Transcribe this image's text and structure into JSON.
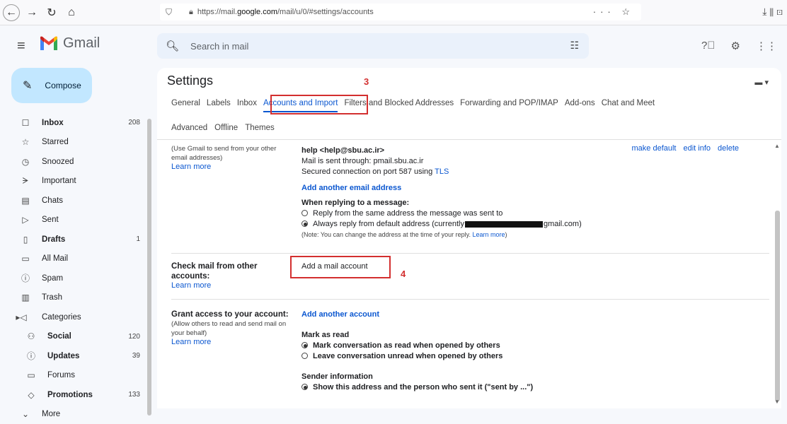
{
  "browser": {
    "url_prefix": "https://mail.",
    "url_domain": "google.com",
    "url_suffix": "/mail/u/0/#settings/accounts",
    "page_actions": "··· ☆",
    "toolbar_icons": "⤓ ⫴ ⊡"
  },
  "header": {
    "app_name": "Gmail",
    "search_placeholder": "Search in mail"
  },
  "sidebar": {
    "compose_label": "Compose",
    "items": [
      {
        "icon": "inbox-icon",
        "glyph": "☐",
        "label": "Inbox",
        "count": "208",
        "bold": true
      },
      {
        "icon": "star-icon",
        "glyph": "☆",
        "label": "Starred",
        "count": ""
      },
      {
        "icon": "clock-icon",
        "glyph": "◷",
        "label": "Snoozed",
        "count": ""
      },
      {
        "icon": "important-icon",
        "glyph": "ᗒ",
        "label": "Important",
        "count": ""
      },
      {
        "icon": "chat-icon",
        "glyph": "▤",
        "label": "Chats",
        "count": ""
      },
      {
        "icon": "send-icon",
        "glyph": "▷",
        "label": "Sent",
        "count": ""
      },
      {
        "icon": "draft-icon",
        "glyph": "▯",
        "label": "Drafts",
        "count": "1",
        "bold": true
      },
      {
        "icon": "all-mail-icon",
        "glyph": "▭",
        "label": "All Mail",
        "count": ""
      },
      {
        "icon": "spam-icon",
        "glyph": "ⓘ",
        "label": "Spam",
        "count": ""
      },
      {
        "icon": "trash-icon",
        "glyph": "▥",
        "label": "Trash",
        "count": ""
      },
      {
        "icon": "category-icon",
        "glyph": "▸◁",
        "label": "Categories",
        "count": ""
      },
      {
        "icon": "social-icon",
        "glyph": "⚇",
        "label": "Social",
        "count": "120",
        "bold": true,
        "sub": true
      },
      {
        "icon": "info-icon",
        "glyph": "ⓘ",
        "label": "Updates",
        "count": "39",
        "bold": true,
        "sub": true
      },
      {
        "icon": "forum-icon",
        "glyph": "▭",
        "label": "Forums",
        "count": "",
        "sub": true
      },
      {
        "icon": "tag-icon",
        "glyph": "◇",
        "label": "Promotions",
        "count": "133",
        "bold": true,
        "sub": true
      },
      {
        "icon": "chevron-down-icon",
        "glyph": "⌄",
        "label": "More",
        "count": ""
      }
    ]
  },
  "settings": {
    "title": "Settings",
    "tabs_row1": [
      "General",
      "Labels",
      "Inbox",
      "Accounts and Import",
      "Filters and Blocked Addresses",
      "Forwarding and POP/IMAP",
      "Add-ons",
      "Chat and Meet"
    ],
    "active_tab": "Accounts and Import",
    "tabs_row2": [
      "Advanced",
      "Offline",
      "Themes"
    ],
    "annotation_3": "3",
    "annotation_4": "4",
    "send_as": {
      "left_line1": "(Use Gmail to send from your other",
      "left_line2": "email addresses)",
      "learn_more": "Learn more",
      "address": "help <help@sbu.ac.ir>",
      "sent_through": "Mail is sent through: pmail.sbu.ac.ir",
      "secured_prefix": "Secured connection on port 587 using ",
      "secured_link": "TLS",
      "make_default": "make default",
      "edit_info": "edit info",
      "delete": "delete",
      "add_another_email": "Add another email address",
      "reply_heading": "When replying to a message:",
      "reply_opt1": "Reply from the same address the message was sent to",
      "reply_opt2_prefix": "Always reply from default address (currently",
      "reply_opt2_suffix": "gmail.com)",
      "note_prefix": "(Note: You can change the address at the time of your reply. ",
      "note_link": "Learn more",
      "note_suffix": ")"
    },
    "check_mail": {
      "heading_line1": "Check mail from other",
      "heading_line2": "accounts:",
      "learn_more": "Learn more",
      "add_mail_account": "Add a mail account"
    },
    "grant_access": {
      "heading": "Grant access to your account:",
      "left_line1": "(Allow others to read and send mail on",
      "left_line2": "your behalf)",
      "learn_more": "Learn more",
      "add_another_account": "Add another account",
      "mark_read_heading": "Mark as read",
      "mark_opt1": "Mark conversation as read when opened by others",
      "mark_opt2": "Leave conversation unread when opened by others",
      "sender_heading": "Sender information",
      "sender_opt1": "Show this address and the person who sent it (\"sent by ...\")"
    }
  }
}
